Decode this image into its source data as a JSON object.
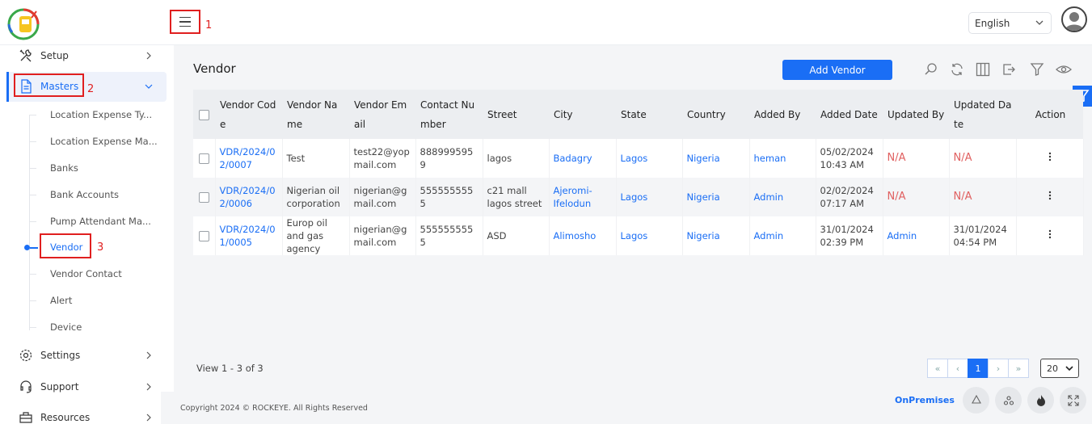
{
  "header": {
    "language": "English"
  },
  "annotations": [
    "1",
    "2",
    "3"
  ],
  "sidebar": {
    "setup": "Setup",
    "masters": "Masters",
    "sub_items": [
      "Location Expense Ty...",
      "Location Expense Ma...",
      "Banks",
      "Bank Accounts",
      "Pump Attendant Ma...",
      "Vendor",
      "Vendor Contact",
      "Alert",
      "Device"
    ],
    "settings": "Settings",
    "support": "Support",
    "resources": "Resources"
  },
  "main": {
    "title": "Vendor",
    "add_button": "Add Vendor",
    "columns": [
      "Vendor Code",
      "Vendor Name",
      "Vendor Email",
      "Contact Number",
      "Street",
      "City",
      "State",
      "Country",
      "Added By",
      "Added Date",
      "Updated By",
      "Updated Date",
      "Action"
    ],
    "rows": [
      {
        "code": "VDR/2024/02/0007",
        "name": "Test",
        "email": "test22@yopmail.com",
        "contact": "8889995959",
        "street": "lagos",
        "city": "Badagry",
        "state": "Lagos",
        "country": "Nigeria",
        "added_by": "heman",
        "added_date": "05/02/2024 10:43 AM",
        "updated_by": "N/A",
        "updated_date": "N/A"
      },
      {
        "code": "VDR/2024/02/0006",
        "name": "Nigerian oil corporation",
        "email": "nigerian@gmail.com",
        "contact": "5555555555",
        "street": "c21 mall lagos street",
        "city": "Ajeromi-Ifelodun",
        "state": "Lagos",
        "country": "Nigeria",
        "added_by": "Admin",
        "added_date": "02/02/2024 07:17 AM",
        "updated_by": "N/A",
        "updated_date": "N/A"
      },
      {
        "code": "VDR/2024/01/0005",
        "name": "Europ oil and gas agency",
        "email": "nigerian@gmail.com",
        "contact": "5555555555",
        "street": "ASD",
        "city": "Alimosho",
        "state": "Lagos",
        "country": "Nigeria",
        "added_by": "Admin",
        "added_date": "31/01/2024 02:39 PM",
        "updated_by": "Admin",
        "updated_date": "31/01/2024 04:54 PM"
      }
    ],
    "view_count": "View 1 - 3 of 3",
    "pager": {
      "first": "«",
      "prev": "‹",
      "current": "1",
      "next": "›",
      "last": "»"
    },
    "page_size": "20"
  },
  "footer": {
    "copyright": "Copyright 2024 © ROCKEYE. All Rights Reserved",
    "mode": "OnPremises"
  },
  "colors": {
    "accent": "#1a6ef5",
    "annotation": "#e01f1f",
    "na": "#e06060"
  }
}
